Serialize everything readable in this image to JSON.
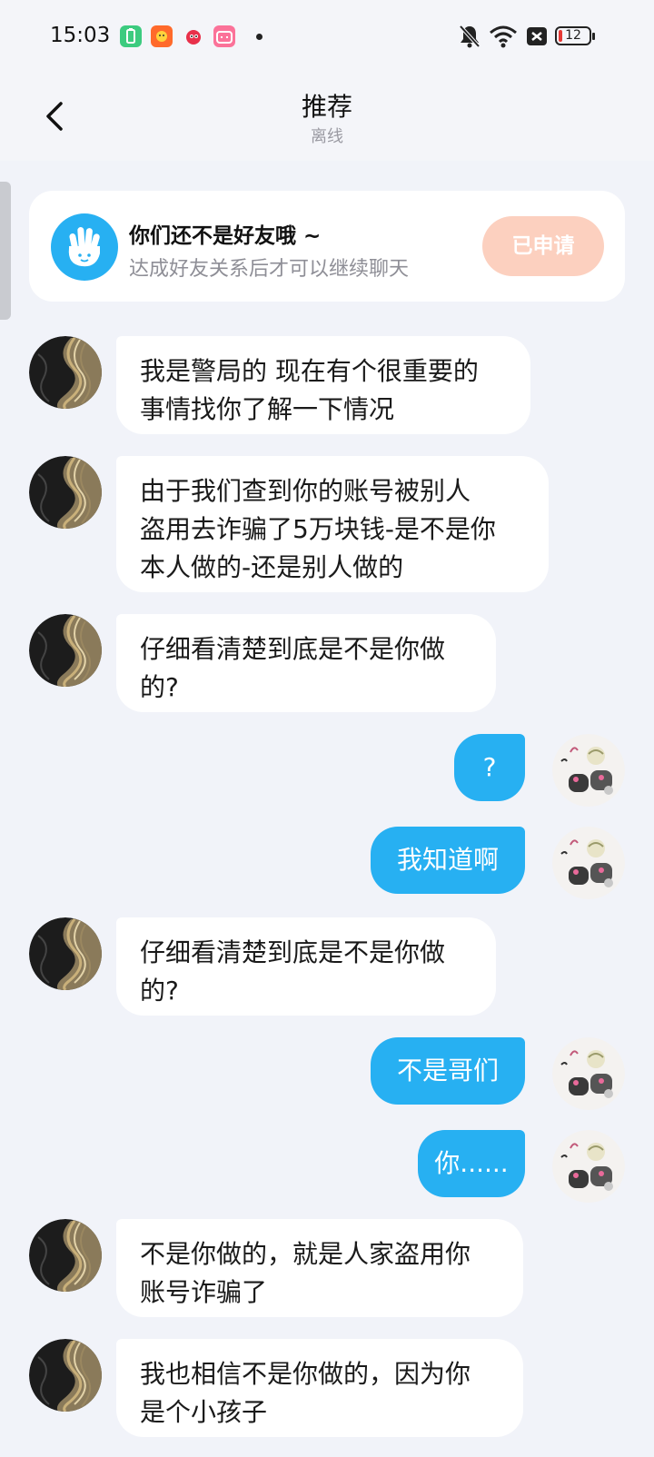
{
  "status_bar": {
    "time": "15:03",
    "battery_level": "12",
    "battery_percent": 12,
    "icons": [
      "battery-saver-app-icon",
      "shop-app-icon",
      "red-character-app-icon",
      "bilibili-app-icon",
      "notification-dot",
      "mute-bell-icon",
      "wifi-icon",
      "sim-blocked-icon",
      "battery-icon"
    ]
  },
  "header": {
    "title": "推荐",
    "subtitle": "离线"
  },
  "friend_notice": {
    "title": "你们还不是好友哦 ~",
    "subtitle": "达成好友关系后才可以继续聊天",
    "button_label": "已申请"
  },
  "colors": {
    "accent": "#27b0f2",
    "applied_button": "#fcd0bf",
    "background": "#f1f3f9"
  },
  "messages": [
    {
      "side": "left",
      "lines": [
        "我是警局的 现在有个很重要的",
        "事情找你了解一下情况"
      ]
    },
    {
      "side": "left",
      "lines": [
        "由于我们查到你的账号被别人",
        "盗用去诈骗了5万块钱-是不是你",
        "本人做的-还是别人做的"
      ]
    },
    {
      "side": "left",
      "lines": [
        "仔细看清楚到底是不是你做",
        "的?"
      ]
    },
    {
      "side": "right",
      "lines": [
        "?"
      ]
    },
    {
      "side": "right",
      "lines": [
        "我知道啊"
      ]
    },
    {
      "side": "left",
      "lines": [
        "仔细看清楚到底是不是你做",
        "的?"
      ]
    },
    {
      "side": "right",
      "lines": [
        "不是哥们"
      ]
    },
    {
      "side": "right",
      "lines": [
        "你......"
      ]
    },
    {
      "side": "left",
      "lines": [
        "不是你做的，就是人家盗用你",
        "账号诈骗了"
      ]
    },
    {
      "side": "left",
      "lines": [
        "我也相信不是你做的，因为你",
        "是个小孩子"
      ]
    }
  ]
}
